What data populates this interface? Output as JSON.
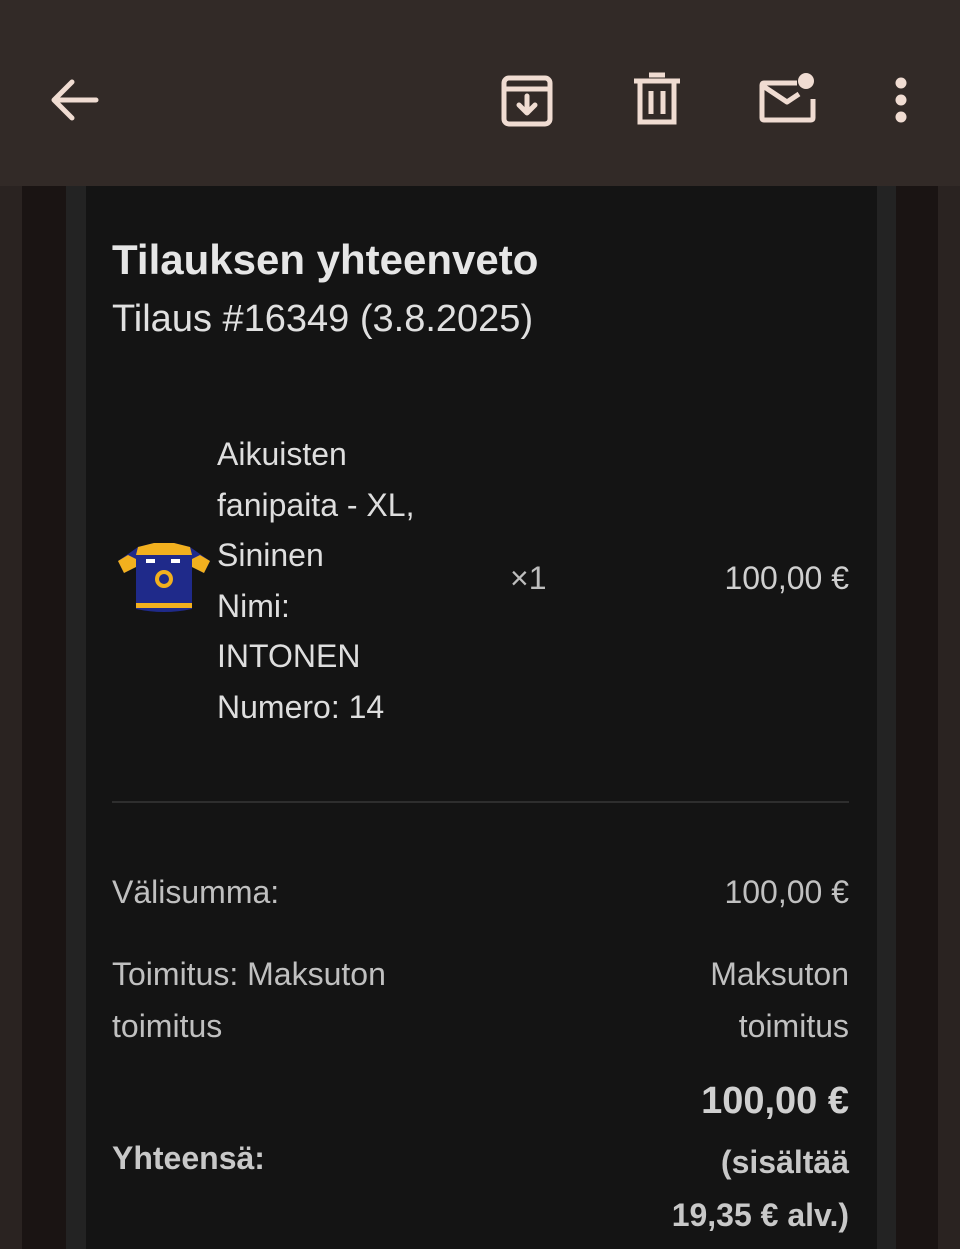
{
  "toolbar": {
    "back_icon": "arrow-left-icon",
    "archive_icon": "archive-icon",
    "delete_icon": "trash-icon",
    "unread_icon": "mark-unread-icon",
    "more_icon": "more-vertical-icon",
    "icon_color": "#f0dcd2"
  },
  "order": {
    "title": "Tilauksen yhteenveto",
    "subtitle": "Tilaus #16349 (3.8.2025)",
    "item": {
      "image": "jersey-icon",
      "lines": [
        "Aikuisten",
        "fanipaita - XL,",
        "Sininen",
        "Nimi:",
        "INTONEN",
        "Numero: 14"
      ],
      "quantity": "×1",
      "price": "100,00 €"
    },
    "subtotal_label": "Välisumma:",
    "subtotal_value": "100,00 €",
    "shipping_label_line1": "Toimitus: Maksuton",
    "shipping_label_line2": "toimitus",
    "shipping_value_line1": "Maksuton",
    "shipping_value_line2": "toimitus",
    "total_label": "Yhteensä:",
    "total_amount": "100,00 €",
    "total_note_line1": "(sisältää",
    "total_note_line2": "19,35 € alv.)"
  }
}
